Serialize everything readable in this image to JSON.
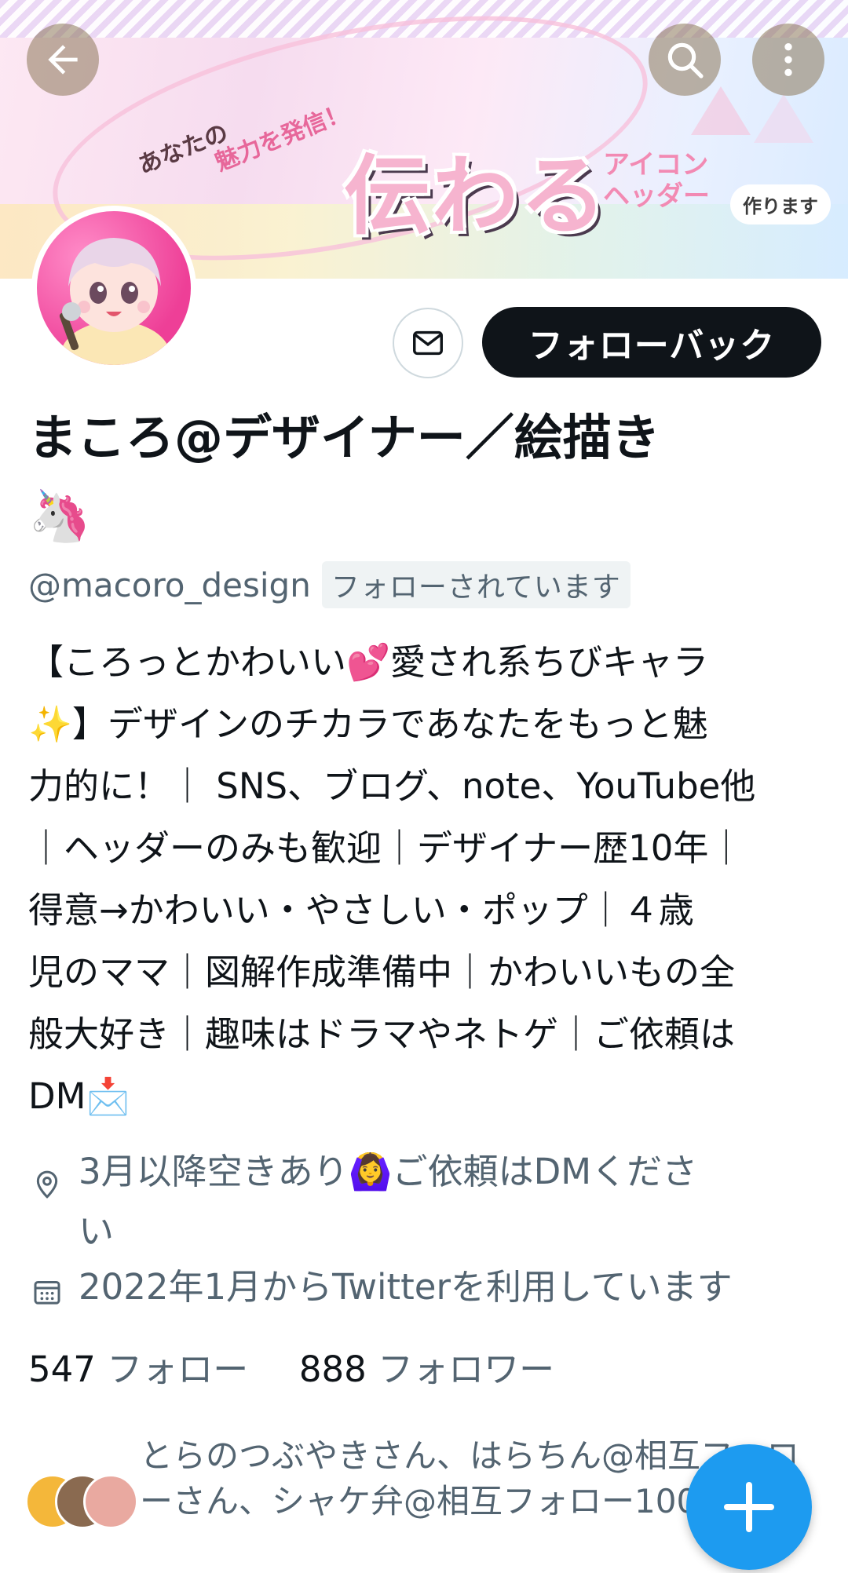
{
  "banner": {
    "small_text_1": "あなたの",
    "small_text_2": "魅力を発信！",
    "big_text": "伝わる",
    "icon_text_1": "アイコン",
    "icon_text_2": "ヘッダー",
    "tag_text": "作ります"
  },
  "profile": {
    "display_name": "まころ@デザイナー／絵描き",
    "name_emoji": "🦄",
    "handle": "@macoro_design",
    "follows_you_badge": "フォローされています",
    "bio_lines": [
      "【ころっとかわいい💕愛され系ちびキャラ",
      "✨】デザインのチカラであなたをもっと魅",
      "力的に！｜ SNS、ブログ、note、YouTube他",
      "｜ヘッダーのみも歓迎｜デザイナー歴10年｜",
      "得意→かわいい・やさしい・ポップ｜４歳",
      "児のママ｜図解作成準備中｜かわいいもの全",
      "般大好き｜趣味はドラマやネトゲ｜ご依頼は",
      "DM📩"
    ],
    "location_line1": "3月以降空きあり🙆‍♀️ご依頼はDMくださ",
    "location_line2": "い",
    "joined": "2022年1月からTwitterを利用しています",
    "following_count": "547",
    "following_label": "フォロー",
    "followers_count": "888",
    "followers_label": "フォロワー",
    "known_followers_line1": "とらのつぶやきさん、はらちん@相互フォロ",
    "known_followers_line2": "ーさん、シャケ弁@相互フォロー100"
  },
  "actions": {
    "follow_back_label": "フォローバック"
  },
  "icons": {
    "back": "back-arrow-icon",
    "search": "search-icon",
    "more": "more-vertical-icon",
    "message": "envelope-icon",
    "location": "location-pin-icon",
    "calendar": "calendar-icon",
    "compose": "plus-icon"
  },
  "colors": {
    "primary_text": "#0f1419",
    "secondary_text": "#536471",
    "accent": "#1d9bf0",
    "button_dark": "#0f1419"
  }
}
